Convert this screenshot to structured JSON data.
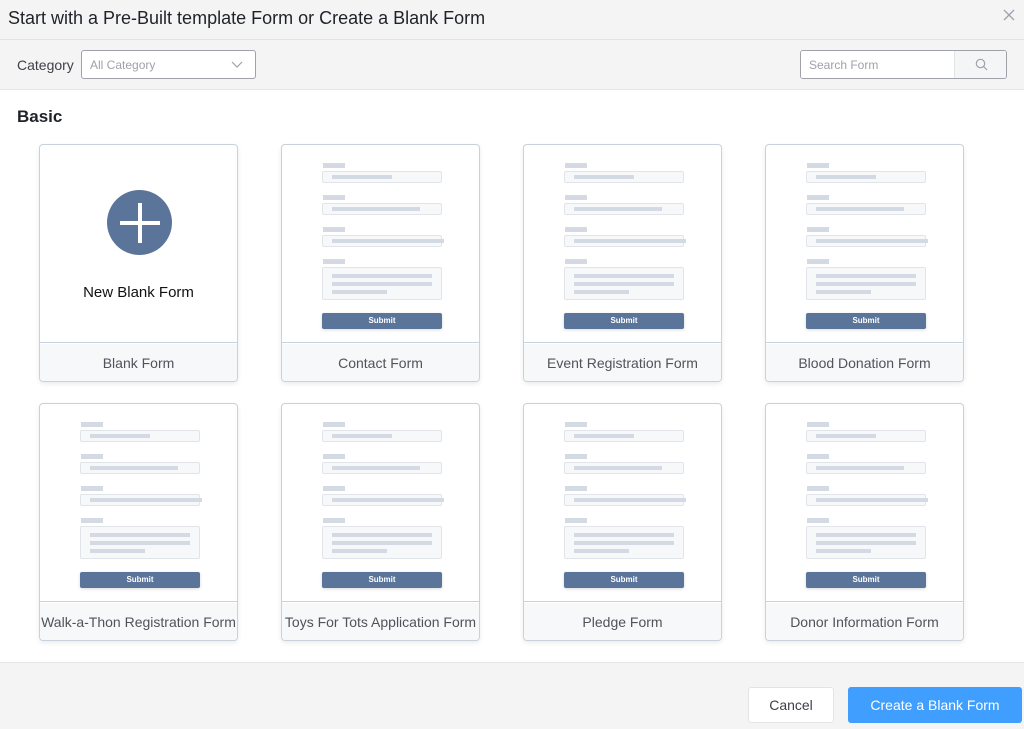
{
  "dialog": {
    "title": "Start with a Pre-Built template Form or Create a Blank Form",
    "close_icon": "close-icon"
  },
  "filters": {
    "category_label": "Category",
    "category_value": "All Category",
    "search_placeholder": "Search Form",
    "search_value": ""
  },
  "section": {
    "title": "Basic"
  },
  "blank_card": {
    "icon": "plus-circle-icon",
    "heading": "New Blank Form",
    "label": "Blank Form"
  },
  "mock_form": {
    "submit_label": "Submit"
  },
  "templates": [
    {
      "label": "Contact Form"
    },
    {
      "label": "Event Registration Form"
    },
    {
      "label": "Blood Donation Form"
    },
    {
      "label": "Walk-a-Thon Registration Form"
    },
    {
      "label": "Toys For Tots Application Form"
    },
    {
      "label": "Pledge Form"
    },
    {
      "label": "Donor Information Form"
    }
  ],
  "footer": {
    "cancel_label": "Cancel",
    "create_label": "Create a Blank Form"
  },
  "colors": {
    "primary": "#409eff",
    "icon_blue": "#5b7499"
  }
}
